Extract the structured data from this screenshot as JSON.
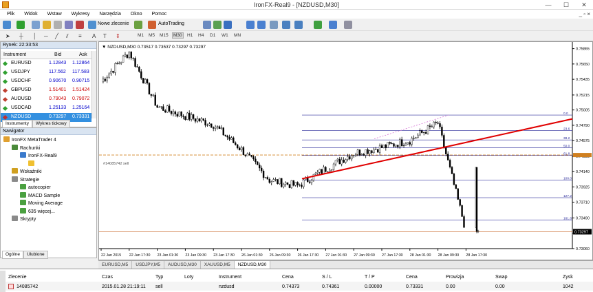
{
  "window": {
    "title": "IronFX-Real9 - [NZDUSD,M30]",
    "minimize": "—",
    "maximize": "☐",
    "close": "✕"
  },
  "menu": [
    "Plik",
    "Widok",
    "Wstaw",
    "Wykresy",
    "Narzędzia",
    "Okno",
    "Pomoc"
  ],
  "toolbar": {
    "new_order": "Nowe zlecenie",
    "autotrading": "AutoTrading",
    "timeframes": [
      "M1",
      "M5",
      "M15",
      "M30",
      "H1",
      "H4",
      "D1",
      "W1",
      "MN"
    ],
    "active_timeframe": "M30"
  },
  "market_watch": {
    "title": "Rynek: 22:33:53",
    "col_instrument": "Instrument",
    "col_bid": "Bid",
    "col_ask": "Ask",
    "rows": [
      {
        "sym": "EURUSD",
        "bid": "1.12843",
        "ask": "1.12864",
        "color": "#0000cc"
      },
      {
        "sym": "USDJPY",
        "bid": "117.562",
        "ask": "117.583",
        "color": "#0000cc"
      },
      {
        "sym": "USDCHF",
        "bid": "0.90670",
        "ask": "0.90715",
        "color": "#0000cc"
      },
      {
        "sym": "GBPUSD",
        "bid": "1.51401",
        "ask": "1.51424",
        "color": "#cc0000"
      },
      {
        "sym": "AUDUSD",
        "bid": "0.79043",
        "ask": "0.79072",
        "color": "#cc0000"
      },
      {
        "sym": "USDCAD",
        "bid": "1.25133",
        "ask": "1.25164",
        "color": "#0000cc"
      },
      {
        "sym": "NZDUSD",
        "bid": "0.73297",
        "ask": "0.73331",
        "color": "#ffffff"
      }
    ],
    "tabs": [
      "Instrumenty",
      "Wykres tickowy"
    ]
  },
  "navigator": {
    "title": "Nawigator",
    "items": [
      {
        "label": "IronFX MetaTrader 4",
        "indent": 0,
        "icon": "#e0a030"
      },
      {
        "label": "Rachunki",
        "indent": 1,
        "icon": "#4a8a3a"
      },
      {
        "label": "IronFX-Real9",
        "indent": 2,
        "icon": "#3a7acc"
      },
      {
        "label": "",
        "indent": 3,
        "icon": "#f0c030"
      },
      {
        "label": "Wskaźniki",
        "indent": 1,
        "icon": "#d0a020"
      },
      {
        "label": "Strategie",
        "indent": 1,
        "icon": "#8a8a8a"
      },
      {
        "label": "autocopier",
        "indent": 2,
        "icon": "#4aa040"
      },
      {
        "label": "MACD Sample",
        "indent": 2,
        "icon": "#4aa040"
      },
      {
        "label": "Moving Average",
        "indent": 2,
        "icon": "#4aa040"
      },
      {
        "label": "635 więcej...",
        "indent": 2,
        "icon": "#4aa040"
      },
      {
        "label": "Skrypty",
        "indent": 1,
        "icon": "#8a8a8a"
      }
    ],
    "tabs": [
      "Ogólne",
      "Ulubione"
    ]
  },
  "chart": {
    "header": "▼ NZDUSD,M30  0.73517 0.73537 0.73297 0.73297",
    "order_label": "#14085742 sell",
    "price_ticks": [
      "0.75865",
      "0.75650",
      "0.75435",
      "0.75215",
      "0.75005",
      "0.74790",
      "0.74575",
      "0.74355",
      "0.74140",
      "0.73925",
      "0.73710",
      "0.73490",
      "0.73275",
      "0.73060"
    ],
    "time_labels": [
      "22 Jan 2015",
      "22 Jan 17:30",
      "23 Jan 01:30",
      "23 Jan 09:30",
      "23 Jan 17:30",
      "26 Jan 01:30",
      "26 Jan 09:30",
      "26 Jan 17:30",
      "27 Jan 01:30",
      "27 Jan 09:30",
      "27 Jan 17:30",
      "28 Jan 01:30",
      "28 Jan 09:30",
      "28 Jan 17:30"
    ],
    "fibo_levels": [
      "0.0",
      "23.6",
      "38.2",
      "50.0",
      "61.8",
      "100.0",
      "127.2",
      "161.8"
    ],
    "last_price": "0.73297",
    "tabs": [
      "EURUSD,M5",
      "USDJPY,M5",
      "AUDUSD,M30",
      "XAUUSD,M5",
      "NZDUSD,M30"
    ],
    "active_tab": "NZDUSD,M30"
  },
  "chart_data": {
    "type": "line",
    "title": "NZDUSD,M30",
    "x": [
      "22 Jan 2015",
      "22 Jan 17:30",
      "23 Jan 01:30",
      "23 Jan 09:30",
      "23 Jan 17:30",
      "26 Jan 01:30",
      "26 Jan 09:30",
      "26 Jan 17:30",
      "27 Jan 01:30",
      "27 Jan 09:30",
      "27 Jan 17:30",
      "28 Jan 01:30",
      "28 Jan 09:30",
      "28 Jan 17:30"
    ],
    "series": [
      {
        "values": [
          0.754,
          0.7582,
          0.7505,
          0.7492,
          0.748,
          0.7445,
          0.7402,
          0.7394,
          0.7418,
          0.744,
          0.7448,
          0.7458,
          0.7482,
          0.733
        ]
      }
    ],
    "ylim": [
      0.7306,
      0.759
    ]
  },
  "terminal": {
    "headers": [
      "Zlecenie",
      "Czas",
      "Typ",
      "Loty",
      "Instrument",
      "Cena",
      "S / L",
      "T / P",
      "Cena",
      "Prowizja",
      "Swap",
      "Zysk"
    ],
    "row": [
      "14085742",
      "2015.01.28 21:19:11",
      "sell",
      "",
      "nzdusd",
      "0.74373",
      "0.74361",
      "0.00000",
      "0.73331",
      "0.00",
      "0.00",
      "1042"
    ]
  }
}
